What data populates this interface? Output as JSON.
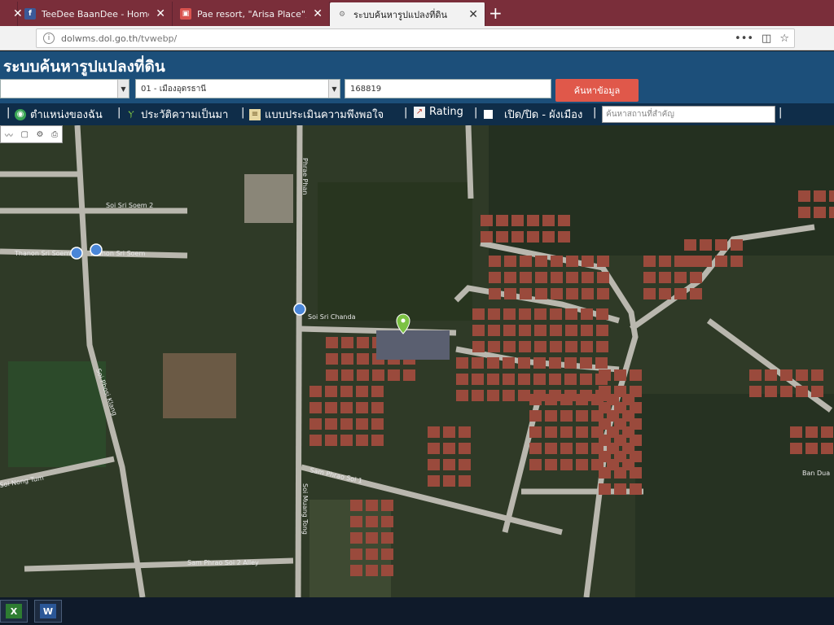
{
  "browser": {
    "tabs": [
      {
        "title": "",
        "favicon": "close-icon"
      },
      {
        "title": "TeeDee BaanDee - Home",
        "favicon": "facebook-icon"
      },
      {
        "title": "Pae resort, \"Arisa Place\", soi so",
        "favicon": "page-icon"
      },
      {
        "title": "ระบบค้นหารูปแปลงที่ดิน",
        "favicon": "gear-icon",
        "active": true
      }
    ],
    "new_tab_label": "+",
    "url_host": "dolwms.dol.go.th",
    "url_path": "/tvwebp/",
    "toolbar_icons": [
      "more-icon",
      "pocket-icon",
      "bookmark-star-icon"
    ]
  },
  "site": {
    "title": "ระบบค้นหารูปแปลงที่ดิน"
  },
  "search": {
    "province_value": "",
    "district_value": "01 - เมืองอุดรธานี",
    "parcel_number": "168819",
    "submit_label": "ค้นหาข้อมูล"
  },
  "menu": {
    "my_location": "ตำแหน่งของฉัน",
    "history": "ประวัติความเป็นมา",
    "survey": "แบบประเมินความพึงพอใจ",
    "rating": "Rating",
    "toggle": "เปิด/ปิด - ผังเมือง",
    "place_search_placeholder": "ค้นหาสถานที่สำคัญ"
  },
  "map": {
    "labels": {
      "road_1": "Thanon Sri Soem",
      "road_2": "Soi Sri Soem 2",
      "road_3": "Thanon Sri Soem",
      "road_4": "Soi Sri Chanda",
      "road_5": "Sam Phrao Soi 1",
      "road_6": "Soi Phosi Klang",
      "road_7": "Phrae Phan",
      "road_8": "Soi Muang Tong",
      "road_9": "Sam Phrao Soi 2 Alley",
      "road_10": "Ban Dua",
      "road_11": "Soi Nong Tum"
    },
    "colors": {
      "vegetation": "#2f3a27",
      "roof": "#9a4a3c",
      "road": "#b9b7ae",
      "pin": "#7cc243"
    }
  },
  "taskbar": {
    "apps": [
      "excel-icon",
      "word-icon"
    ]
  }
}
